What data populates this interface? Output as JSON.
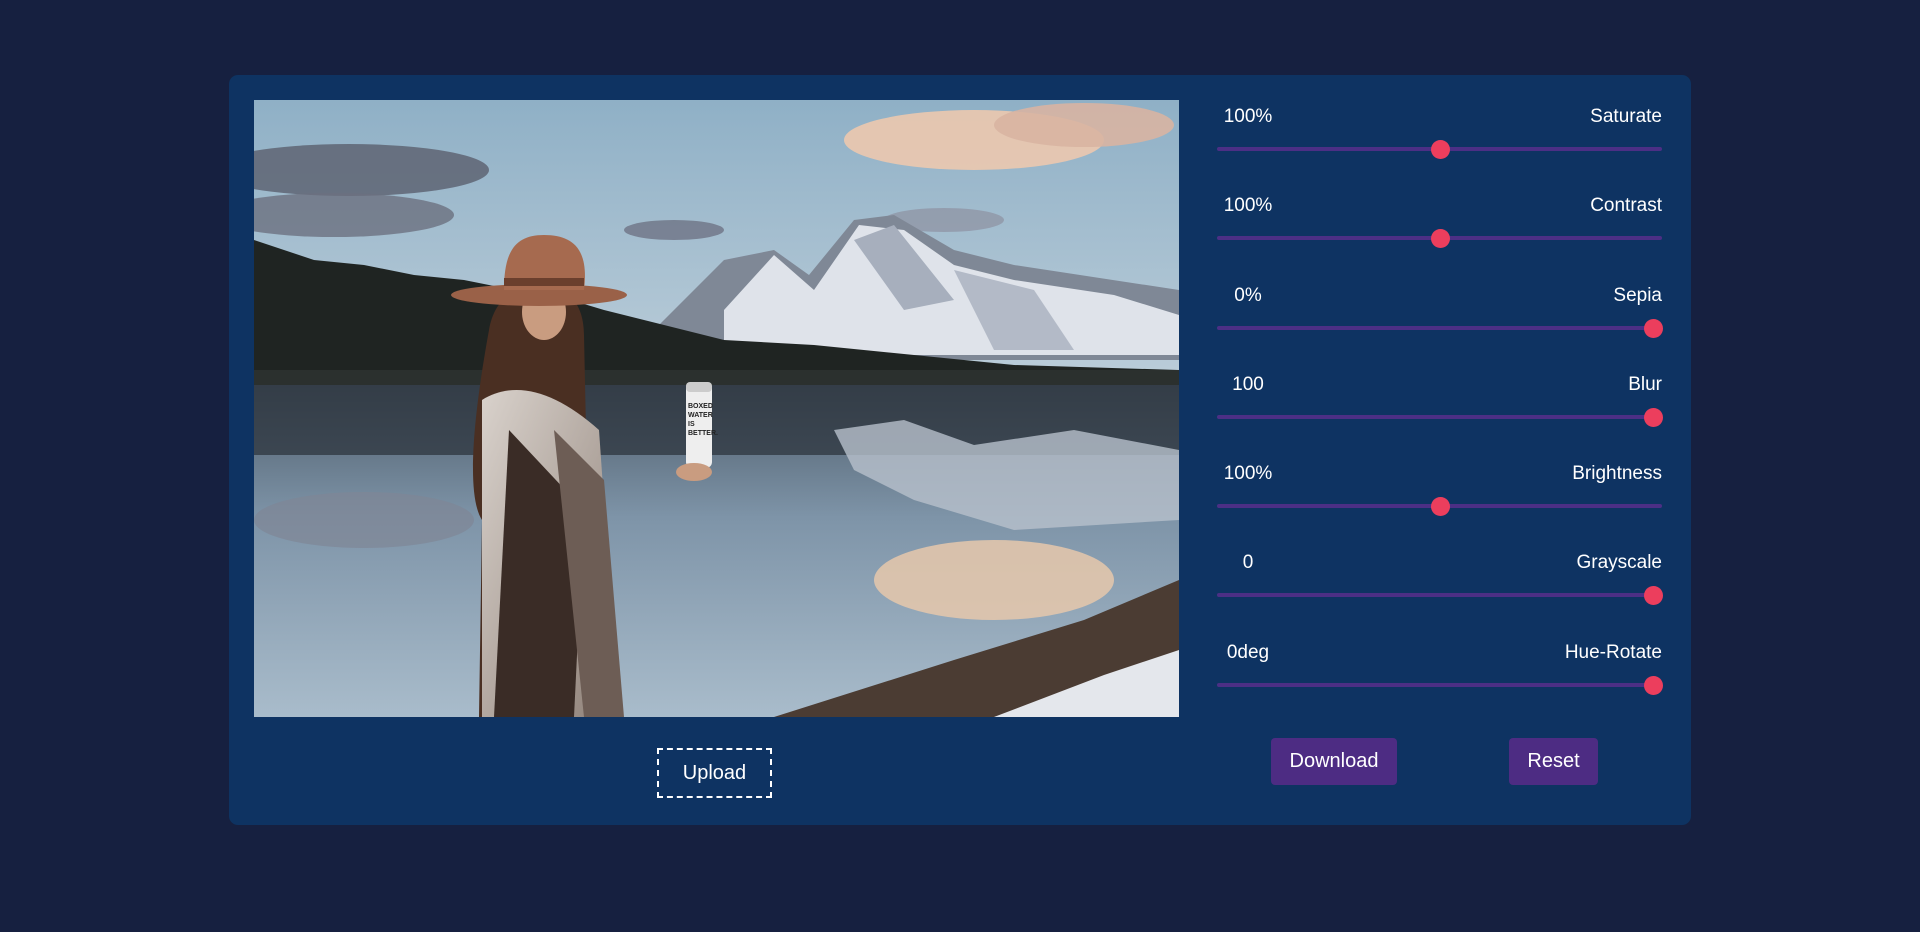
{
  "photo": {
    "subject": "woman in hat holding a can by a mountain lake",
    "can_text": [
      "BOXED",
      "WATER",
      "IS",
      "BETTER."
    ]
  },
  "upload": {
    "label": "Upload"
  },
  "filters": [
    {
      "value_text": "100%",
      "label": "Saturate",
      "level": 0.5
    },
    {
      "value_text": "100%",
      "label": "Contrast",
      "level": 0.5
    },
    {
      "value_text": "0%",
      "label": "Sepia",
      "level": 0.98
    },
    {
      "value_text": "100",
      "label": "Blur",
      "level": 0.98
    },
    {
      "value_text": "100%",
      "label": "Brightness",
      "level": 0.5
    },
    {
      "value_text": "0",
      "label": "Grayscale",
      "level": 0.98
    },
    {
      "value_text": "0deg",
      "label": "Hue-Rotate",
      "level": 0.98
    }
  ],
  "actions": {
    "download": "Download",
    "reset": "Reset"
  },
  "colors": {
    "background": "#162040",
    "card": "#0e3362",
    "track": "#4c2f85",
    "thumb": "#ec3e5d",
    "button": "#4d2c83"
  }
}
